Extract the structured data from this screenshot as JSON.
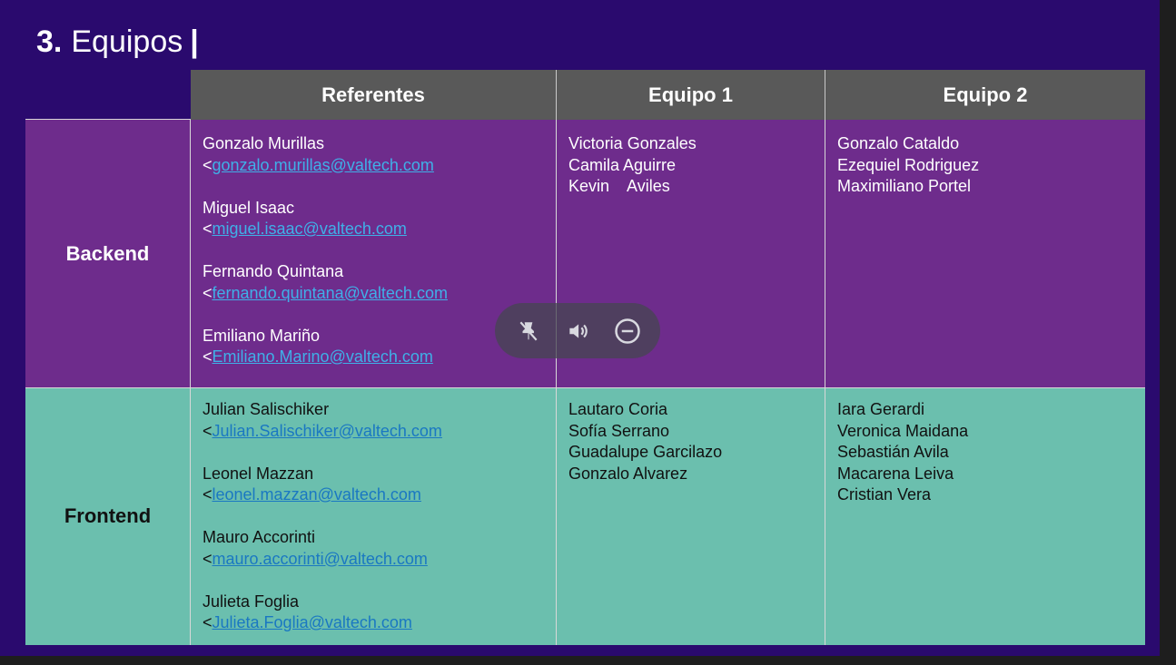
{
  "slide": {
    "number": "3.",
    "title": "Equipos",
    "cursor": "|"
  },
  "table": {
    "headers": [
      "Referentes",
      "Equipo 1",
      "Equipo 2"
    ],
    "rows": [
      {
        "label": "Backend",
        "referentes": [
          {
            "name": "Gonzalo Murillas",
            "email": "gonzalo.murillas@valtech.com"
          },
          {
            "name": "Miguel Isaac",
            "email": "miguel.isaac@valtech.com"
          },
          {
            "name": "Fernando Quintana",
            "email": "fernando.quintana@valtech.com"
          },
          {
            "name": "Emiliano Mariño",
            "email": "Emiliano.Marino@valtech.com"
          }
        ],
        "equipo1": [
          "Victoria Gonzales",
          "Camila Aguirre",
          "Kevin    Aviles"
        ],
        "equipo2": [
          "Gonzalo Cataldo",
          "Ezequiel Rodriguez",
          "Maximiliano Portel"
        ]
      },
      {
        "label": "Frontend",
        "referentes": [
          {
            "name": "Julian Salischiker",
            "email": "Julian.Salischiker@valtech.com"
          },
          {
            "name": "Leonel Mazzan",
            "email": "leonel.mazzan@valtech.com"
          },
          {
            "name": "Mauro Accorinti",
            "email": "mauro.accorinti@valtech.com"
          },
          {
            "name": "Julieta Foglia",
            "email": "Julieta.Foglia@valtech.com"
          }
        ],
        "equipo1": [
          "Lautaro Coria",
          "Sofía Serrano",
          "Guadalupe Garcilazo",
          "Gonzalo Alvarez"
        ],
        "equipo2": [
          "Iara Gerardi",
          "Veronica Maidana",
          "Sebastián Avila",
          "Macarena Leiva",
          "Cristian Vera"
        ]
      }
    ],
    "email_prefix": "<"
  },
  "overlay_controls": {
    "buttons": [
      {
        "icon": "unpin-icon"
      },
      {
        "icon": "volume-icon"
      },
      {
        "icon": "minus-circle-icon"
      }
    ]
  },
  "colors": {
    "slide_background": "#2a0a6e",
    "header_background": "#595959",
    "backend_background": "#6e2c8c",
    "frontend_background": "#6bbfae",
    "link": "#3fb0e8"
  }
}
